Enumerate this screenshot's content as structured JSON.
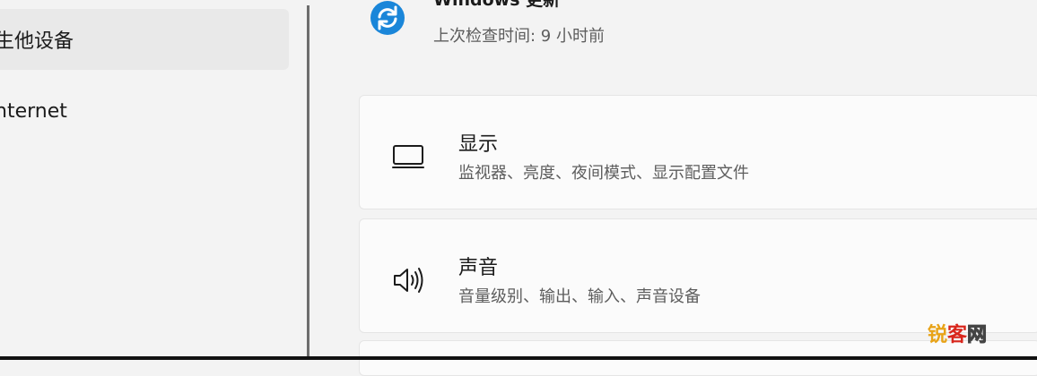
{
  "sidebar": {
    "items": [
      {
        "label": "蓝牙和其他设备",
        "visible_label": "生他设备",
        "selected": true
      },
      {
        "label": "网络和 Internet",
        "visible_label": "nternet",
        "selected": false
      }
    ]
  },
  "update": {
    "icon": "sync-icon",
    "title": "Windows 更新",
    "subtitle": "上次检查时间: 9 小时前",
    "accent": "#0067c0"
  },
  "cards": [
    {
      "icon": "monitor-icon",
      "title": "显示",
      "subtitle": "监视器、亮度、夜间模式、显示配置文件"
    },
    {
      "icon": "speaker-icon",
      "title": "声音",
      "subtitle": "音量级别、输出、输入、声音设备"
    }
  ],
  "watermark": {
    "part1": "锐",
    "part2": "客",
    "part3": "网"
  },
  "colors": {
    "background": "#f3f3f3",
    "card": "#fbfbfb",
    "selected": "#e9e9e9",
    "secondary_text": "#5d5d5d"
  }
}
